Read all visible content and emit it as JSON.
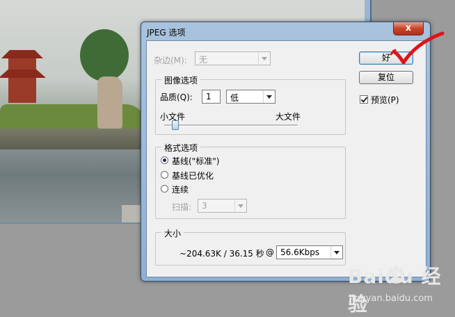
{
  "dialog": {
    "title": "JPEG 选项",
    "close_label": "x"
  },
  "matte": {
    "label": "杂边(M):",
    "value": "无"
  },
  "image_options": {
    "group_label": "图像选项",
    "quality_label": "品质(Q):",
    "quality_value": "1",
    "quality_preset": "低",
    "small_label": "小文件",
    "large_label": "大文件",
    "slider_level_fraction": 0.08
  },
  "format_options": {
    "group_label": "格式选项",
    "options": [
      "基线(\"标准\")",
      "基线已优化",
      "连续"
    ],
    "selected": "基线(\"标准\")",
    "scans_label": "扫描:",
    "scans_value": "3"
  },
  "size": {
    "group_label": "大小",
    "summary": "~204.63K / 36.15 秒",
    "at_symbol": "@",
    "speed_value": "56.6Kbps"
  },
  "buttons": {
    "ok_label": "好",
    "reset_label": "复位"
  },
  "preview": {
    "label": "预览(P)",
    "checked": true
  },
  "watermark": {
    "logo_text": "Baidu 经验",
    "url_text": "jingyan.baidu.com"
  },
  "colors": {
    "annotation_red": "#e0131a",
    "title_blue": "#9fbbd8"
  }
}
